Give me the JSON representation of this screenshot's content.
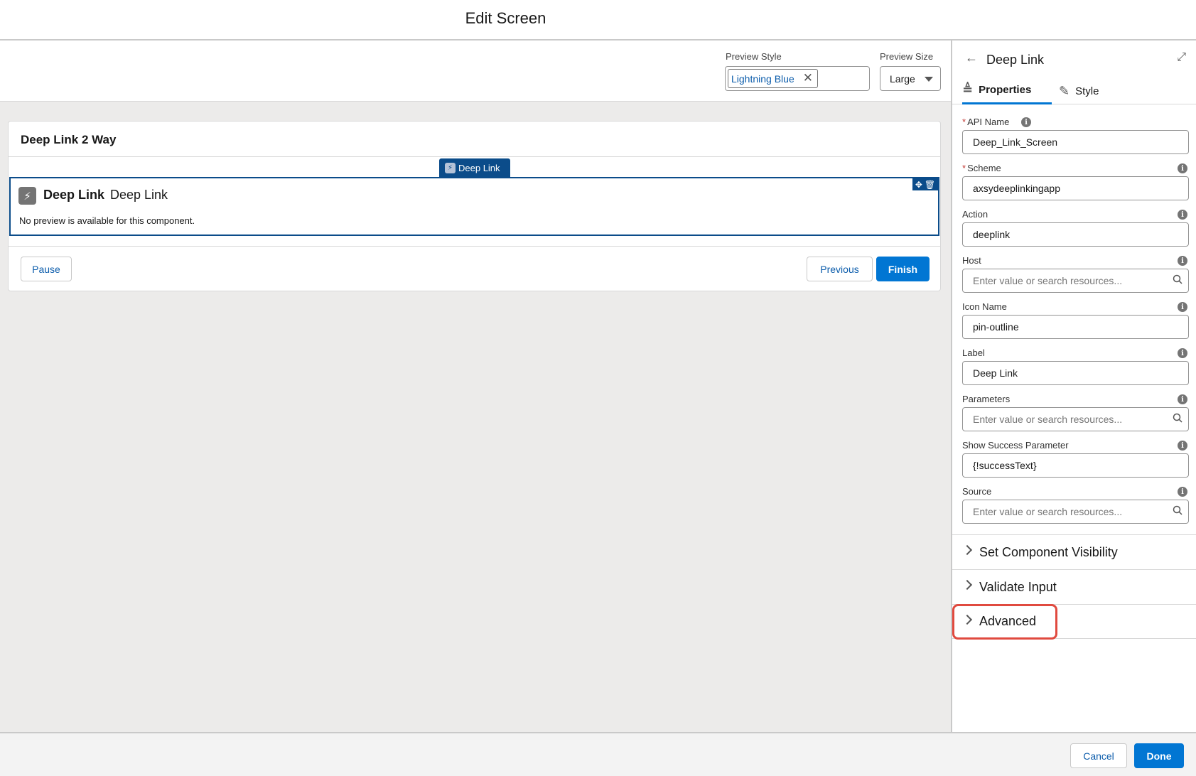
{
  "header": {
    "title": "Edit Screen"
  },
  "toolbar": {
    "preview_style_label": "Preview Style",
    "preview_style_value": "Lightning Blue",
    "preview_size_label": "Preview Size",
    "preview_size_value": "Large"
  },
  "screen": {
    "title": "Deep Link 2 Way",
    "component_tag": "Deep Link",
    "component_name": "Deep Link",
    "component_label": "Deep Link",
    "component_note": "No preview is available for this component.",
    "pause_label": "Pause",
    "previous_label": "Previous",
    "finish_label": "Finish"
  },
  "panel": {
    "title": "Deep Link",
    "tabs": [
      {
        "label": "Properties",
        "icon": "text-properties-icon",
        "active": true
      },
      {
        "label": "Style",
        "icon": "brush-icon",
        "active": false
      }
    ],
    "fields": [
      {
        "label": "API Name",
        "required": true,
        "value": "Deep_Link_Screen",
        "placeholder": "",
        "search": false
      },
      {
        "label": "Scheme",
        "required": true,
        "value": "axsydeeplinkingapp",
        "placeholder": "",
        "search": false
      },
      {
        "label": "Action",
        "required": false,
        "value": "deeplink",
        "placeholder": "",
        "search": false
      },
      {
        "label": "Host",
        "required": false,
        "value": "",
        "placeholder": "Enter value or search resources...",
        "search": true
      },
      {
        "label": "Icon Name",
        "required": false,
        "value": "pin-outline",
        "placeholder": "",
        "search": false
      },
      {
        "label": "Label",
        "required": false,
        "value": "Deep Link",
        "placeholder": "",
        "search": false
      },
      {
        "label": "Parameters",
        "required": false,
        "value": "",
        "placeholder": "Enter value or search resources...",
        "search": true
      },
      {
        "label": "Show Success Parameter",
        "required": false,
        "value": "{!successText}",
        "placeholder": "",
        "search": false
      },
      {
        "label": "Source",
        "required": false,
        "value": "",
        "placeholder": "Enter value or search resources...",
        "search": true
      }
    ],
    "sections": [
      "Set Component Visibility",
      "Validate Input",
      "Advanced"
    ]
  },
  "footer": {
    "cancel_label": "Cancel",
    "done_label": "Done"
  },
  "colors": {
    "brand": "#0176d3",
    "selection": "#0b4c8a",
    "highlight": "#e04a3f"
  }
}
